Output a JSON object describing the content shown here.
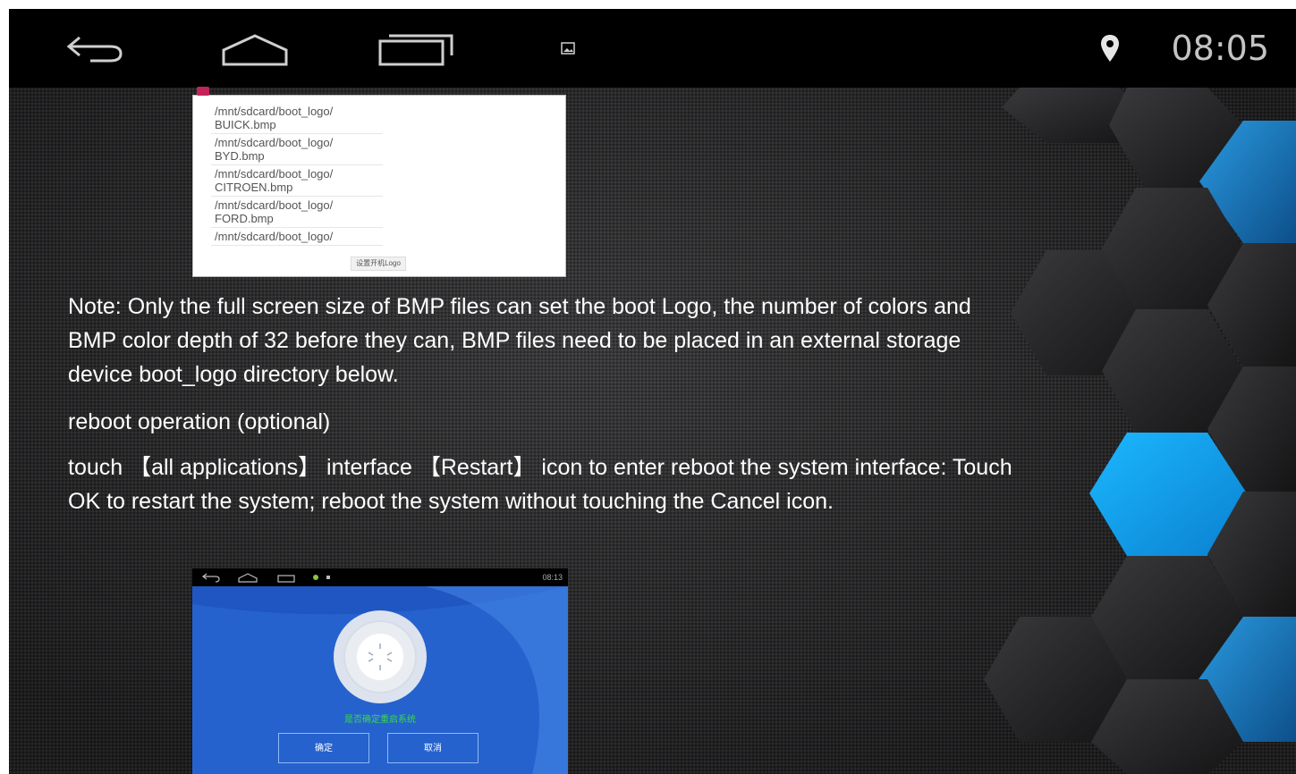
{
  "status_bar": {
    "icons": [
      "back-icon",
      "home-icon",
      "recents-icon",
      "image-notification-icon",
      "location-pin-icon"
    ],
    "time": "08:05"
  },
  "screenshot_file_list": {
    "items": [
      "/mnt/sdcard/boot_logo/ BUICK.bmp",
      "/mnt/sdcard/boot_logo/ BYD.bmp",
      "/mnt/sdcard/boot_logo/ CITROEN.bmp",
      "/mnt/sdcard/boot_logo/ FORD.bmp",
      "/mnt/sdcard/boot_logo/"
    ],
    "button": "设置开机Logo"
  },
  "manual": {
    "note": "Note: Only the full screen size of BMP files can set the boot Logo, the number of colors and BMP color depth of 32 before they can, BMP files need to be placed in an external storage device boot_logo directory below.",
    "reboot_heading": "reboot operation (optional)",
    "reboot_text": "touch 【all applications】 interface 【Restart】 icon to enter reboot the system interface: Touch OK to restart the system; reboot the system without touching the Cancel icon."
  },
  "screenshot_restart": {
    "time": "08:13",
    "prompt": "是否确定重启系统",
    "ok": "确定",
    "cancel": "取消"
  },
  "colors": {
    "background": "#2c2c2e",
    "status_bar": "#000000",
    "hex_blue": "#1f7fc4",
    "hex_cyan": "#12a4f0",
    "dialog_blue": "#1f56c2"
  }
}
